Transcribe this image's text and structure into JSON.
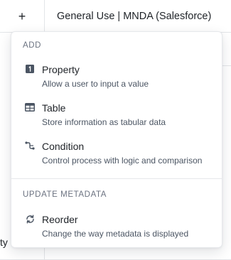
{
  "table": {
    "add_button": "+",
    "column_header": "General Use | MNDA (Salesforce)",
    "clipped_cell_text": "ty"
  },
  "menu": {
    "section_add": "ADD",
    "items_add": [
      {
        "title": "Property",
        "description": "Allow a user to input a value",
        "icon": "property-icon"
      },
      {
        "title": "Table",
        "description": "Store information as tabular data",
        "icon": "table-icon"
      },
      {
        "title": "Condition",
        "description": "Control process with logic and comparison",
        "icon": "condition-icon"
      }
    ],
    "section_metadata": "UPDATE METADATA",
    "items_metadata": [
      {
        "title": "Reorder",
        "description": "Change the way metadata is displayed",
        "icon": "reorder-icon"
      }
    ]
  }
}
